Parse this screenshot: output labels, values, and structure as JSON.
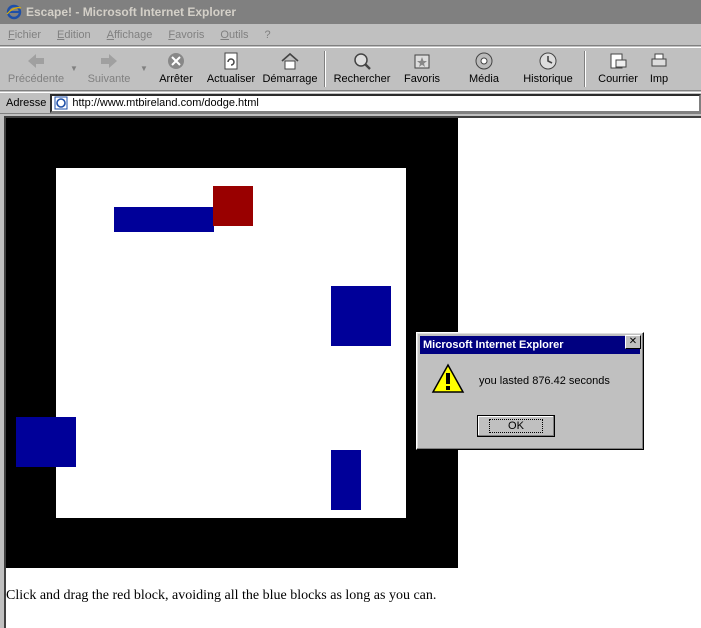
{
  "window": {
    "title": "Escape! - Microsoft Internet Explorer"
  },
  "menu": [
    "Fichier",
    "Edition",
    "Affichage",
    "Favoris",
    "Outils",
    "?"
  ],
  "toolbar": {
    "back": "Précédente",
    "forward": "Suivante",
    "stop": "Arrêter",
    "refresh": "Actualiser",
    "home": "Démarrage",
    "search": "Rechercher",
    "favorites": "Favoris",
    "media": "Média",
    "history": "Historique",
    "mail": "Courrier",
    "print": "Imp"
  },
  "address": {
    "label": "Adresse",
    "url": "http://www.mtbireland.com/dodge.html"
  },
  "page": {
    "instructions": "Click and drag the red block, avoiding all the blue blocks as long as you can.",
    "colors": {
      "arena": "#000000",
      "board": "#ffffff",
      "blue": "#000099",
      "red": "#990000"
    }
  },
  "dialog": {
    "title": "Microsoft Internet Explorer",
    "message": "you lasted 876.42 seconds",
    "ok_label": "OK",
    "icon": "warning-icon"
  }
}
